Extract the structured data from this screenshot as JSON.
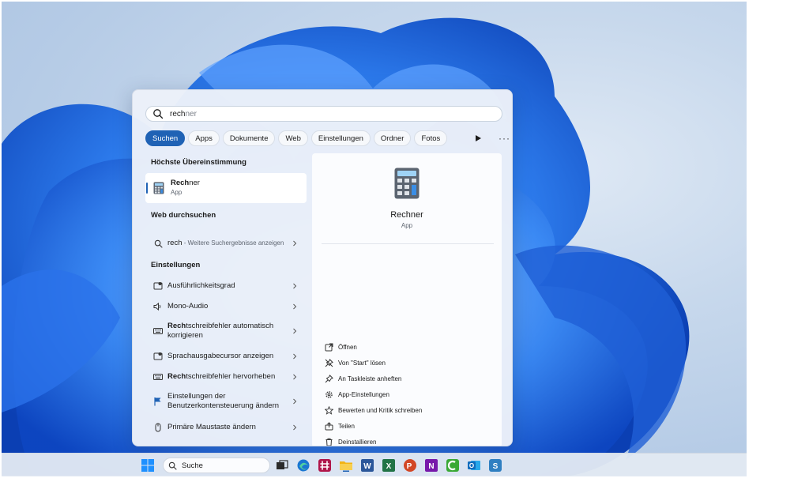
{
  "search": {
    "query_bold": "rech",
    "query_rest": "ner"
  },
  "filters": [
    {
      "label": "Suchen",
      "active": true
    },
    {
      "label": "Apps"
    },
    {
      "label": "Dokumente"
    },
    {
      "label": "Web"
    },
    {
      "label": "Einstellungen"
    },
    {
      "label": "Ordner"
    },
    {
      "label": "Fotos"
    }
  ],
  "sections": {
    "best_match": "Höchste Übereinstimmung",
    "web": "Web durchsuchen",
    "settings": "Einstellungen"
  },
  "best_match": {
    "name_bold": "Rech",
    "name_rest": "ner",
    "type": "App"
  },
  "web_result": {
    "term": "rech",
    "hint": " - Weitere Suchergebnisse anzeigen"
  },
  "settings_items": [
    {
      "bold": "",
      "text": "Ausführlichkeitsgrad"
    },
    {
      "bold": "",
      "text": "Mono-Audio"
    },
    {
      "bold": "Rech",
      "text": "tschreibfehler automatisch korrigieren"
    },
    {
      "bold": "",
      "text": "Sprachausgabecursor anzeigen"
    },
    {
      "bold": "Rech",
      "text": "tschreibfehler hervorheben"
    },
    {
      "bold": "",
      "text": "Einstellungen der Benutzerkontensteuerung ändern"
    },
    {
      "bold": "",
      "text": "Primäre Maustaste ändern"
    }
  ],
  "detail": {
    "title": "Rechner",
    "subtitle": "App",
    "actions": [
      {
        "label": "Öffnen",
        "icon": "open-icon"
      },
      {
        "label": "Von \"Start\" lösen",
        "icon": "unpin-icon"
      },
      {
        "label": "An Taskleiste anheften",
        "icon": "pin-icon"
      },
      {
        "label": "App-Einstellungen",
        "icon": "gear-icon"
      },
      {
        "label": "Bewerten und Kritik schreiben",
        "icon": "star-icon"
      },
      {
        "label": "Teilen",
        "icon": "share-icon"
      },
      {
        "label": "Deinstallieren",
        "icon": "trash-icon"
      }
    ]
  },
  "taskbar": {
    "search_label": "Suche",
    "apps": [
      {
        "name": "Task View",
        "color": "#2b2b2b"
      },
      {
        "name": "Edge",
        "color": "#1976d2"
      },
      {
        "name": "Slack",
        "color": "#b0164a"
      },
      {
        "name": "File Explorer",
        "color": "#f2b417"
      },
      {
        "name": "Word",
        "color": "#2b579a"
      },
      {
        "name": "Excel",
        "color": "#217346"
      },
      {
        "name": "PowerPoint",
        "color": "#d24726"
      },
      {
        "name": "OneNote",
        "color": "#7719aa"
      },
      {
        "name": "Camtasia",
        "color": "#3aa935"
      },
      {
        "name": "Outlook",
        "color": "#0f6cbd"
      },
      {
        "name": "Snagit",
        "color": "#2f7fc1"
      }
    ]
  },
  "colors": {
    "accent": "#1f62b5"
  }
}
